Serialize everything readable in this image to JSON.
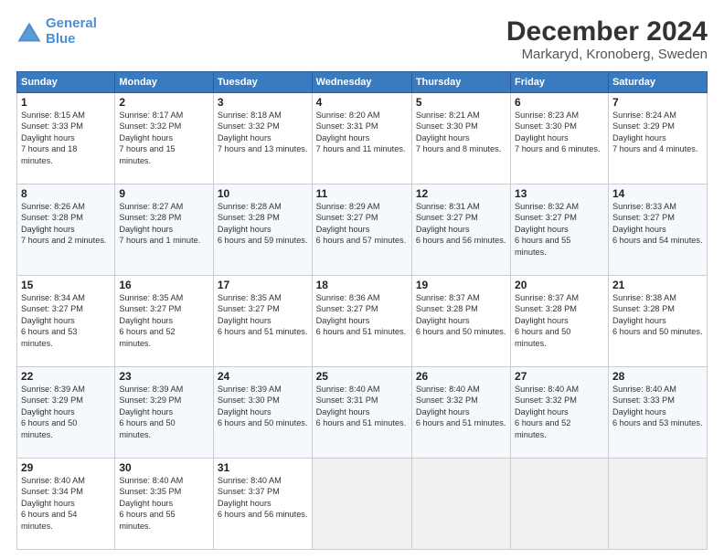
{
  "header": {
    "logo_line1": "General",
    "logo_line2": "Blue",
    "main_title": "December 2024",
    "subtitle": "Markaryd, Kronoberg, Sweden"
  },
  "days_of_week": [
    "Sunday",
    "Monday",
    "Tuesday",
    "Wednesday",
    "Thursday",
    "Friday",
    "Saturday"
  ],
  "weeks": [
    [
      {
        "day": 1,
        "sunrise": "8:15 AM",
        "sunset": "3:33 PM",
        "daylight": "7 hours and 18 minutes."
      },
      {
        "day": 2,
        "sunrise": "8:17 AM",
        "sunset": "3:32 PM",
        "daylight": "7 hours and 15 minutes."
      },
      {
        "day": 3,
        "sunrise": "8:18 AM",
        "sunset": "3:32 PM",
        "daylight": "7 hours and 13 minutes."
      },
      {
        "day": 4,
        "sunrise": "8:20 AM",
        "sunset": "3:31 PM",
        "daylight": "7 hours and 11 minutes."
      },
      {
        "day": 5,
        "sunrise": "8:21 AM",
        "sunset": "3:30 PM",
        "daylight": "7 hours and 8 minutes."
      },
      {
        "day": 6,
        "sunrise": "8:23 AM",
        "sunset": "3:30 PM",
        "daylight": "7 hours and 6 minutes."
      },
      {
        "day": 7,
        "sunrise": "8:24 AM",
        "sunset": "3:29 PM",
        "daylight": "7 hours and 4 minutes."
      }
    ],
    [
      {
        "day": 8,
        "sunrise": "8:26 AM",
        "sunset": "3:28 PM",
        "daylight": "7 hours and 2 minutes."
      },
      {
        "day": 9,
        "sunrise": "8:27 AM",
        "sunset": "3:28 PM",
        "daylight": "7 hours and 1 minute."
      },
      {
        "day": 10,
        "sunrise": "8:28 AM",
        "sunset": "3:28 PM",
        "daylight": "6 hours and 59 minutes."
      },
      {
        "day": 11,
        "sunrise": "8:29 AM",
        "sunset": "3:27 PM",
        "daylight": "6 hours and 57 minutes."
      },
      {
        "day": 12,
        "sunrise": "8:31 AM",
        "sunset": "3:27 PM",
        "daylight": "6 hours and 56 minutes."
      },
      {
        "day": 13,
        "sunrise": "8:32 AM",
        "sunset": "3:27 PM",
        "daylight": "6 hours and 55 minutes."
      },
      {
        "day": 14,
        "sunrise": "8:33 AM",
        "sunset": "3:27 PM",
        "daylight": "6 hours and 54 minutes."
      }
    ],
    [
      {
        "day": 15,
        "sunrise": "8:34 AM",
        "sunset": "3:27 PM",
        "daylight": "6 hours and 53 minutes."
      },
      {
        "day": 16,
        "sunrise": "8:35 AM",
        "sunset": "3:27 PM",
        "daylight": "6 hours and 52 minutes."
      },
      {
        "day": 17,
        "sunrise": "8:35 AM",
        "sunset": "3:27 PM",
        "daylight": "6 hours and 51 minutes."
      },
      {
        "day": 18,
        "sunrise": "8:36 AM",
        "sunset": "3:27 PM",
        "daylight": "6 hours and 51 minutes."
      },
      {
        "day": 19,
        "sunrise": "8:37 AM",
        "sunset": "3:28 PM",
        "daylight": "6 hours and 50 minutes."
      },
      {
        "day": 20,
        "sunrise": "8:37 AM",
        "sunset": "3:28 PM",
        "daylight": "6 hours and 50 minutes."
      },
      {
        "day": 21,
        "sunrise": "8:38 AM",
        "sunset": "3:28 PM",
        "daylight": "6 hours and 50 minutes."
      }
    ],
    [
      {
        "day": 22,
        "sunrise": "8:39 AM",
        "sunset": "3:29 PM",
        "daylight": "6 hours and 50 minutes."
      },
      {
        "day": 23,
        "sunrise": "8:39 AM",
        "sunset": "3:29 PM",
        "daylight": "6 hours and 50 minutes."
      },
      {
        "day": 24,
        "sunrise": "8:39 AM",
        "sunset": "3:30 PM",
        "daylight": "6 hours and 50 minutes."
      },
      {
        "day": 25,
        "sunrise": "8:40 AM",
        "sunset": "3:31 PM",
        "daylight": "6 hours and 51 minutes."
      },
      {
        "day": 26,
        "sunrise": "8:40 AM",
        "sunset": "3:32 PM",
        "daylight": "6 hours and 51 minutes."
      },
      {
        "day": 27,
        "sunrise": "8:40 AM",
        "sunset": "3:32 PM",
        "daylight": "6 hours and 52 minutes."
      },
      {
        "day": 28,
        "sunrise": "8:40 AM",
        "sunset": "3:33 PM",
        "daylight": "6 hours and 53 minutes."
      }
    ],
    [
      {
        "day": 29,
        "sunrise": "8:40 AM",
        "sunset": "3:34 PM",
        "daylight": "6 hours and 54 minutes."
      },
      {
        "day": 30,
        "sunrise": "8:40 AM",
        "sunset": "3:35 PM",
        "daylight": "6 hours and 55 minutes."
      },
      {
        "day": 31,
        "sunrise": "8:40 AM",
        "sunset": "3:37 PM",
        "daylight": "6 hours and 56 minutes."
      },
      null,
      null,
      null,
      null
    ]
  ]
}
